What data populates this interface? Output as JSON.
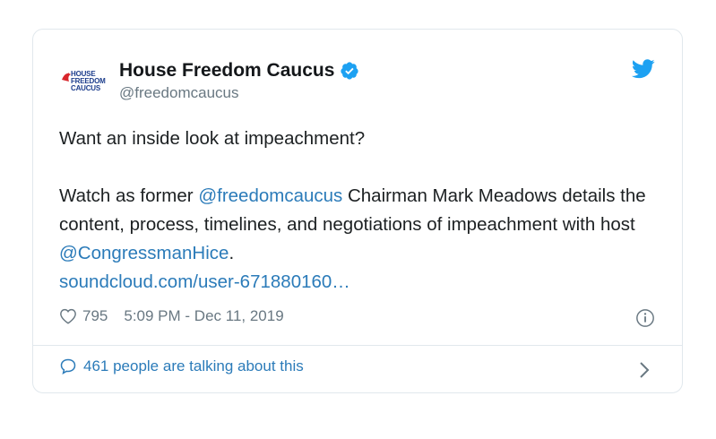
{
  "tweet": {
    "author": {
      "display_name": "House Freedom Caucus",
      "handle": "@freedomcaucus",
      "avatar_logo": [
        "HOUSE",
        "FREEDOM",
        "CAUCUS"
      ]
    },
    "line1": "Want an inside look at impeachment?",
    "p2_part1": "Watch as former ",
    "p2_mention1": "@freedomcaucus",
    "p2_part2": " Chairman Mark Meadows details the content, process, timelines, and negotiations of impeachment with host ",
    "p2_mention2": "@CongressmanHice",
    "p2_part3": ".",
    "link": "soundcloud.com/user-671880160…",
    "likes": "795",
    "timestamp": "5:09 PM - Dec 11, 2019",
    "talking": "461 people are talking about this"
  },
  "colors": {
    "link": "#2b7bb9",
    "verified": "#1da1f2",
    "twitter": "#1da1f2",
    "muted": "#697882"
  },
  "icons": [
    "verified-badge-icon",
    "twitter-bird-icon",
    "heart-icon",
    "info-icon",
    "speech-bubble-icon",
    "chevron-right-icon"
  ]
}
